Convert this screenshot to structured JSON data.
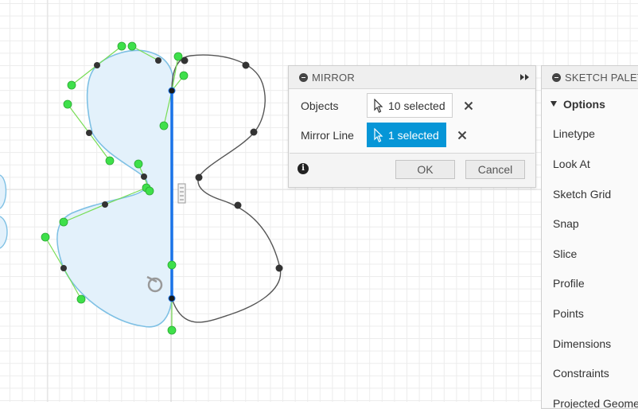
{
  "mirror_dialog": {
    "title": "MIRROR",
    "objects_label": "Objects",
    "objects_value": "10 selected",
    "mirror_line_label": "Mirror Line",
    "mirror_line_value": "1 selected",
    "ok_label": "OK",
    "cancel_label": "Cancel"
  },
  "sketch_palette": {
    "title": "SKETCH PALETTE",
    "section_label": "Options",
    "items": [
      {
        "label": "Linetype"
      },
      {
        "label": "Look At"
      },
      {
        "label": "Sketch Grid"
      },
      {
        "label": "Snap"
      },
      {
        "label": "Slice"
      },
      {
        "label": "Profile"
      },
      {
        "label": "Points"
      },
      {
        "label": "Dimensions"
      },
      {
        "label": "Constraints"
      },
      {
        "label": "Projected Geometries"
      }
    ]
  },
  "colors": {
    "accent": "#0696d7",
    "mirror_line": "#1a73e8",
    "profile_fill": "#e3f1fb",
    "profile_stroke": "#7ec0e4",
    "handle_green": "#33dd33",
    "curve_gray": "#555555"
  },
  "icons": {
    "collapse": "collapse-icon",
    "expand": "double-chevron-right-icon",
    "cursor": "cursor-arrow-icon",
    "clear": "close-icon",
    "info": "info-icon",
    "section_toggle": "triangle-down-icon",
    "symmetry_constraint": "symmetry-constraint-icon",
    "coincident_constraint": "coincident-constraint-icon"
  }
}
